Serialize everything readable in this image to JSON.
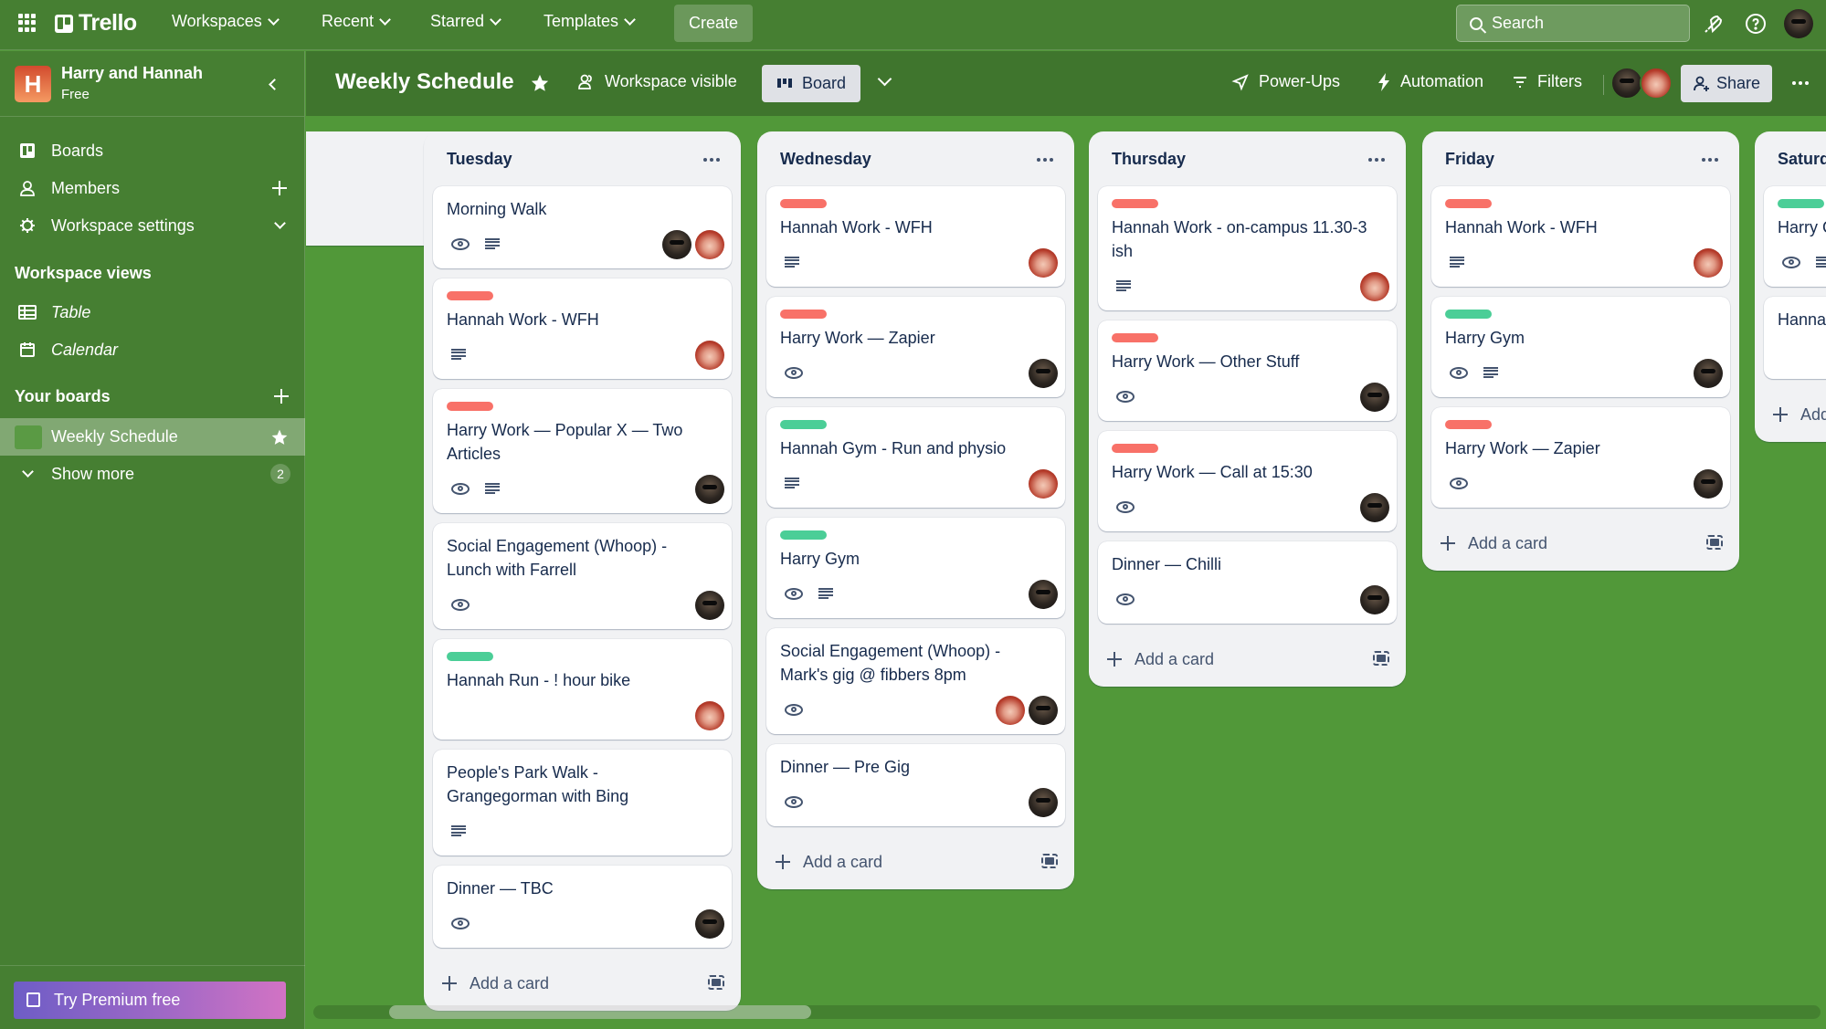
{
  "topbar": {
    "app_name": "Trello",
    "nav": [
      {
        "label": "Workspaces"
      },
      {
        "label": "Recent"
      },
      {
        "label": "Starred"
      },
      {
        "label": "Templates"
      }
    ],
    "create_label": "Create",
    "search_placeholder": "Search",
    "icons": [
      "apps-grid-icon",
      "notifications-icon",
      "help-icon",
      "user-avatar"
    ]
  },
  "sidebar": {
    "workspace_initial": "H",
    "workspace_name": "Harry and Hannah",
    "workspace_plan": "Free",
    "items": [
      {
        "label": "Boards",
        "icon": "board-icon"
      },
      {
        "label": "Members",
        "icon": "person-icon"
      },
      {
        "label": "Workspace settings",
        "icon": "gear-icon"
      }
    ],
    "views_heading": "Workspace views",
    "views": [
      {
        "label": "Table",
        "icon": "table-icon"
      },
      {
        "label": "Calendar",
        "icon": "calendar-icon"
      }
    ],
    "boards_heading": "Your boards",
    "boards": [
      {
        "label": "Weekly Schedule",
        "starred": true,
        "color": "#5a9a44"
      }
    ],
    "show_more_label": "Show more",
    "show_more_count": "2",
    "premium_label": "Try Premium free"
  },
  "board_header": {
    "title": "Weekly Schedule",
    "visibility": "Workspace visible",
    "view": "Board",
    "powerups": "Power-Ups",
    "automation": "Automation",
    "filters": "Filters",
    "share": "Share"
  },
  "colors": {
    "label_red": "#f87168",
    "label_green": "#4bce97",
    "board_bg": "#519839",
    "topbar_bg": "#467f32"
  },
  "lists": [
    {
      "title": "",
      "cards": []
    },
    {
      "title": "Tuesday",
      "add_card_label": "Add a card",
      "cards": [
        {
          "title": "Morning Walk",
          "label": null,
          "watch": true,
          "desc": true,
          "members": [
            "harry",
            "hannah"
          ]
        },
        {
          "title": "Hannah Work - WFH",
          "label": "red",
          "watch": false,
          "desc": true,
          "members": [
            "hannah"
          ]
        },
        {
          "title": "Harry Work — Popular X — Two Articles",
          "label": "red",
          "watch": true,
          "desc": true,
          "members": [
            "harry"
          ]
        },
        {
          "title": "Social Engagement (Whoop) - Lunch with Farrell",
          "label": null,
          "watch": true,
          "desc": false,
          "members": [
            "harry"
          ]
        },
        {
          "title": "Hannah Run - ! hour bike",
          "label": "green",
          "watch": false,
          "desc": false,
          "members": [
            "hannah"
          ]
        },
        {
          "title": "People's Park Walk - Grangegorman with Bing",
          "label": null,
          "watch": false,
          "desc": true,
          "members": []
        },
        {
          "title": "Dinner — TBC",
          "label": null,
          "watch": true,
          "desc": false,
          "members": [
            "harry"
          ]
        }
      ]
    },
    {
      "title": "Wednesday",
      "add_card_label": "Add a card",
      "cards": [
        {
          "title": "Hannah Work - WFH",
          "label": "red",
          "watch": false,
          "desc": true,
          "members": [
            "hannah"
          ]
        },
        {
          "title": "Harry Work — Zapier",
          "label": "red",
          "watch": true,
          "desc": false,
          "members": [
            "harry"
          ]
        },
        {
          "title": "Hannah Gym - Run and physio",
          "label": "green",
          "watch": false,
          "desc": true,
          "members": [
            "hannah"
          ]
        },
        {
          "title": "Harry Gym",
          "label": "green",
          "watch": true,
          "desc": true,
          "members": [
            "harry"
          ]
        },
        {
          "title": "Social Engagement (Whoop) - Mark's gig @ fibbers 8pm",
          "label": null,
          "watch": true,
          "desc": false,
          "members": [
            "hannah",
            "harry"
          ]
        },
        {
          "title": "Dinner — Pre Gig",
          "label": null,
          "watch": true,
          "desc": false,
          "members": [
            "harry"
          ]
        }
      ]
    },
    {
      "title": "Thursday",
      "add_card_label": "Add a card",
      "cards": [
        {
          "title": "Hannah Work - on-campus 11.30-3 ish",
          "label": "red",
          "watch": false,
          "desc": true,
          "members": [
            "hannah"
          ]
        },
        {
          "title": "Harry Work — Other Stuff",
          "label": "red",
          "watch": true,
          "desc": false,
          "members": [
            "harry"
          ]
        },
        {
          "title": "Harry Work — Call at 15:30",
          "label": "red",
          "watch": true,
          "desc": false,
          "members": [
            "harry"
          ]
        },
        {
          "title": "Dinner — Chilli",
          "label": null,
          "watch": true,
          "desc": false,
          "members": [
            "harry"
          ]
        }
      ]
    },
    {
      "title": "Friday",
      "add_card_label": "Add a card",
      "cards": [
        {
          "title": "Hannah Work - WFH",
          "label": "red",
          "watch": false,
          "desc": true,
          "members": [
            "hannah"
          ]
        },
        {
          "title": "Harry Gym",
          "label": "green",
          "watch": true,
          "desc": true,
          "members": [
            "harry"
          ]
        },
        {
          "title": "Harry Work — Zapier",
          "label": "red",
          "watch": true,
          "desc": false,
          "members": [
            "harry"
          ]
        }
      ]
    },
    {
      "title": "Saturday",
      "add_card_label": "Add a card",
      "cards": [
        {
          "title": "Harry Gym",
          "label": "green",
          "watch": true,
          "desc": true,
          "members": []
        },
        {
          "title": "Hannah",
          "label": null,
          "watch": false,
          "desc": false,
          "members": []
        }
      ]
    }
  ],
  "scroll": {
    "thumb_start_fraction": 0.05,
    "thumb_size_fraction": 0.28
  }
}
